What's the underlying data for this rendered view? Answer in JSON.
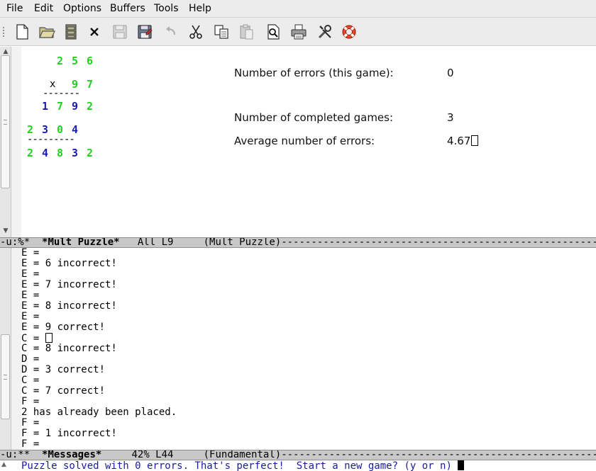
{
  "menu": [
    "File",
    "Edit",
    "Options",
    "Buffers",
    "Tools",
    "Help"
  ],
  "toolbar": [
    {
      "name": "new-file-icon"
    },
    {
      "name": "open-folder-icon"
    },
    {
      "name": "dired-cabinet-icon"
    },
    {
      "name": "close-buffer-icon"
    },
    {
      "name": "save-icon"
    },
    {
      "name": "save-as-icon"
    },
    {
      "name": "undo-icon"
    },
    {
      "name": "cut-icon"
    },
    {
      "name": "copy-icon"
    },
    {
      "name": "paste-icon"
    },
    {
      "name": "search-icon"
    },
    {
      "name": "print-icon"
    },
    {
      "name": "preferences-icon"
    },
    {
      "name": "help-lifebuoy-icon"
    }
  ],
  "puzzle": {
    "multiplicand": [
      "2",
      "5",
      "6"
    ],
    "times_sign": "x",
    "multiplier": [
      "9",
      "7"
    ],
    "partial1": [
      "1",
      "7",
      "9",
      "2"
    ],
    "partial2": [
      "2",
      "3",
      "0",
      "4"
    ],
    "result": [
      "2",
      "4",
      "8",
      "3",
      "2"
    ],
    "rule_short": "-------",
    "rule_long": "---------",
    "colors": {
      "placed": "#22d022",
      "given": "#1b1bb0"
    }
  },
  "stats": {
    "errors_label": "Number of errors (this game):",
    "errors_value": "0",
    "completed_label": "Number of completed games:",
    "completed_value": "3",
    "average_label": "Average number of errors:",
    "average_value": "4.67"
  },
  "modeline_top": {
    "prefix": "-u:%*  ",
    "buffer": "*Mult Puzzle*",
    "pos": "   All L9     ",
    "mode": "(Mult Puzzle)",
    "tail": "----------------------------------------------------------------------------------------------"
  },
  "messages": [
    "E =",
    "E = 6 incorrect!",
    "E =",
    "E = 7 incorrect!",
    "E =",
    "E = 8 incorrect!",
    "E =",
    "E = 9 correct!",
    "C = ",
    "C = 8 incorrect!",
    "D =",
    "D = 3 correct!",
    "C =",
    "C = 7 correct!",
    "F =",
    "2 has already been placed.",
    "F =",
    "F = 1 incorrect!",
    "F ="
  ],
  "modeline_bottom": {
    "prefix": "-u:**  ",
    "buffer": "*Messages*",
    "pos": "     42% L44     ",
    "mode": "(Fundamental)",
    "tail": "----------------------------------------------------------------------------------------------"
  },
  "echo": "Puzzle solved with 0 errors. That's perfect!  Start a new game? (y or n)"
}
